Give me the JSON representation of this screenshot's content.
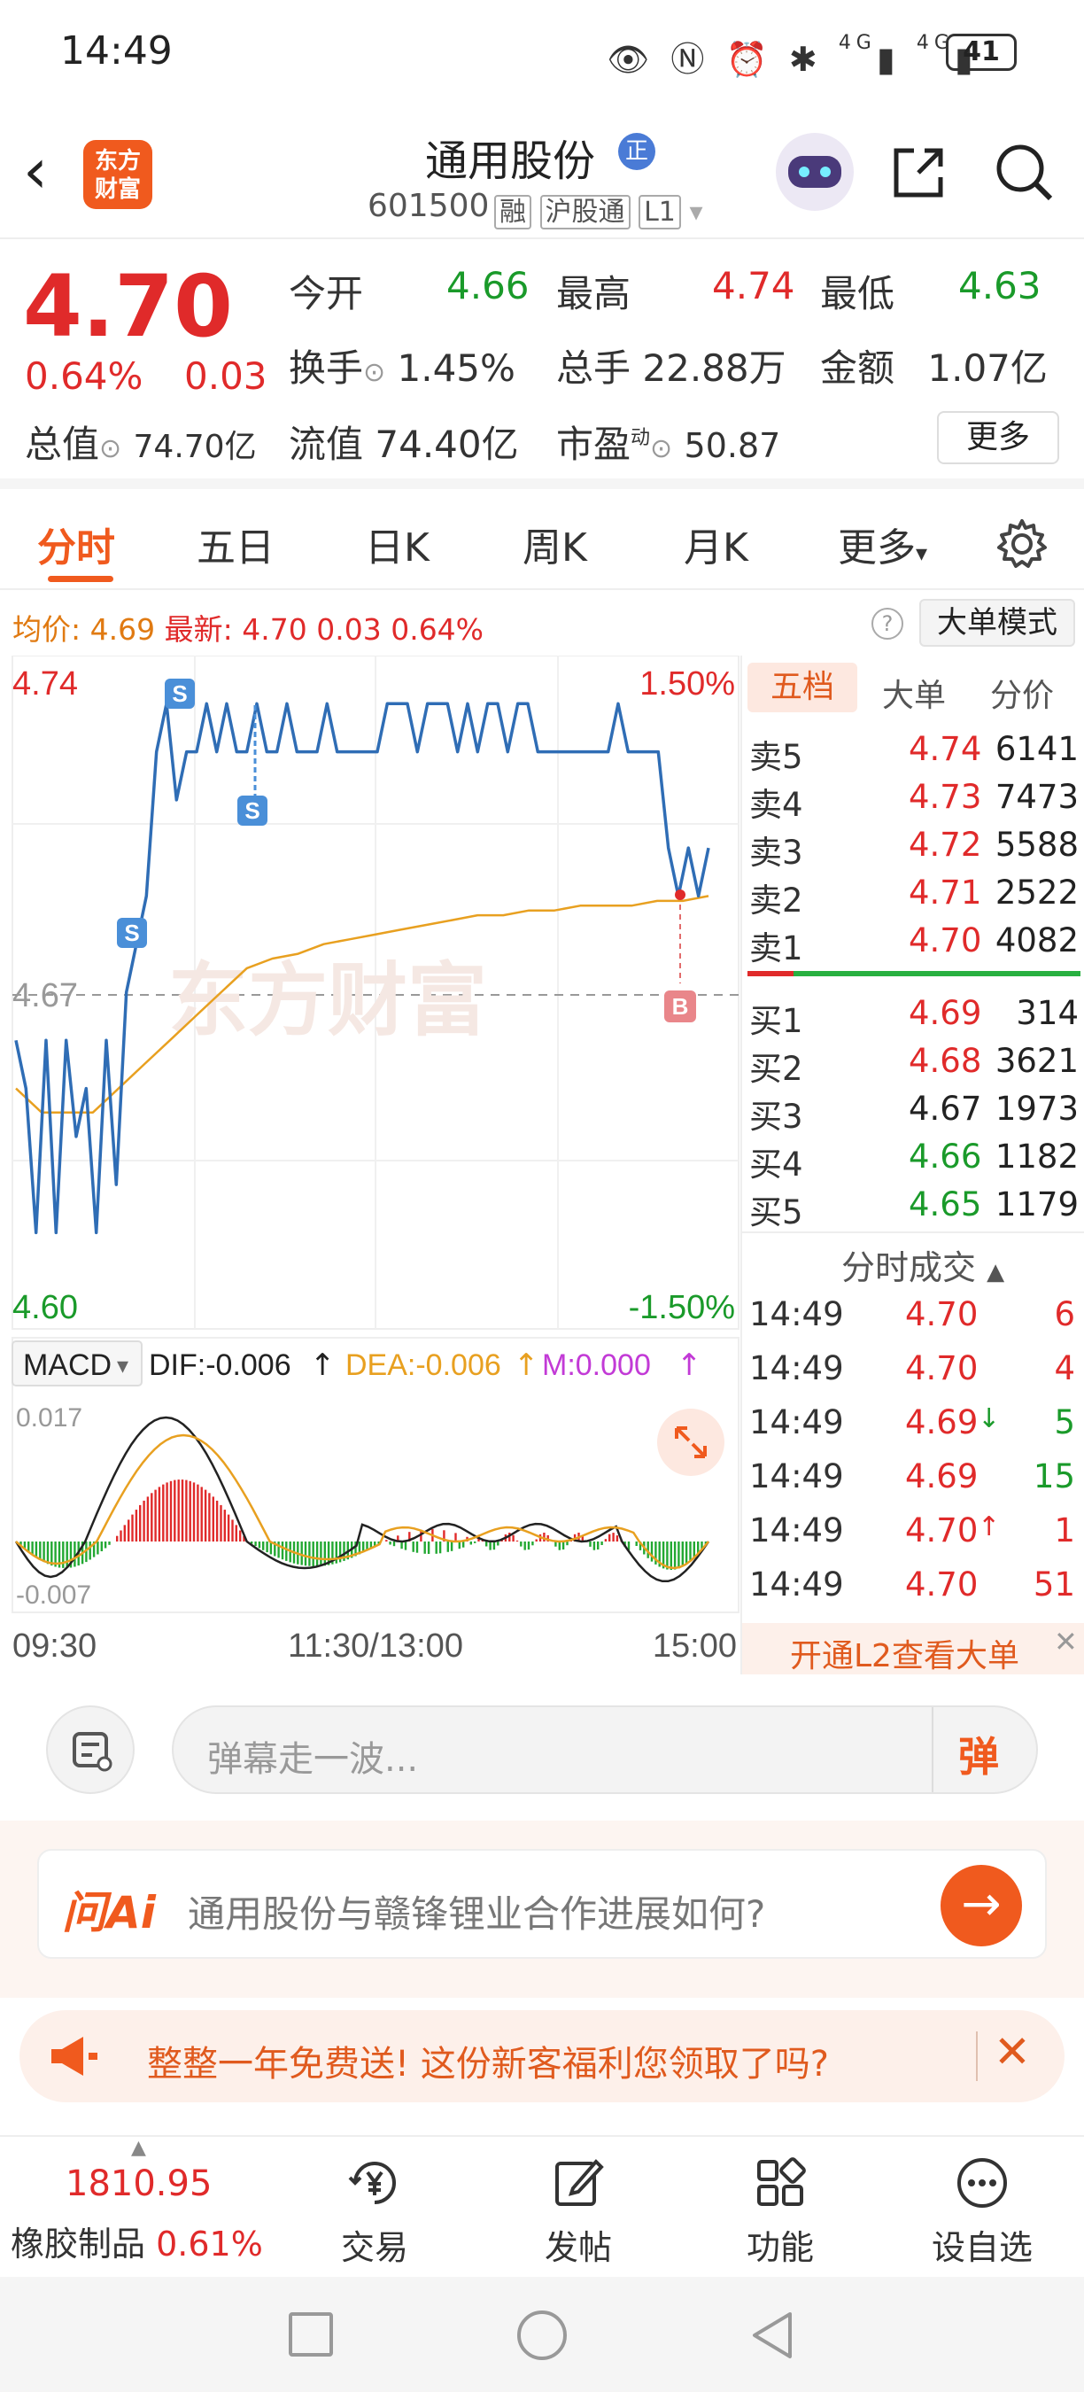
{
  "status_bar": {
    "time": "14:49",
    "battery": "41",
    "network1": "4G",
    "network2": "4G"
  },
  "header": {
    "logo_text": "东方财富",
    "stock_name": "通用股份",
    "name_badge": "正",
    "code": "601500",
    "tags": [
      "融",
      "沪股通",
      "L1"
    ]
  },
  "quote": {
    "price": "4.70",
    "change_pct": "0.64%",
    "change": "0.03",
    "total_value_label": "总值",
    "total_value": "74.70亿",
    "fields": [
      {
        "label": "今开",
        "value": "4.66"
      },
      {
        "label": "最高",
        "value": "4.74"
      },
      {
        "label": "最低",
        "value": "4.63"
      },
      {
        "label": "换手",
        "value": "1.45%"
      },
      {
        "label": "总手",
        "value": "22.88万"
      },
      {
        "label": "金额",
        "value": "1.07亿"
      },
      {
        "label": "流值",
        "value": "74.40亿"
      },
      {
        "label": "市盈",
        "sup": "动",
        "value": "50.87"
      }
    ],
    "more_label": "更多"
  },
  "tabs": [
    "分时",
    "五日",
    "日K",
    "周K",
    "月K",
    "更多"
  ],
  "avg_line": {
    "avg_label": "均价:",
    "avg_value": "4.69",
    "latest_label": "最新:",
    "latest_value": "4.70",
    "change": "0.03",
    "change_pct": "0.64%",
    "mode_button": "大单模式"
  },
  "chart": {
    "y_high": "4.74",
    "y_mid": "4.67",
    "y_low": "4.60",
    "pct_high": "1.50%",
    "pct_low": "-1.50%",
    "watermark": "东方财富",
    "marker_s": "S",
    "marker_b": "B",
    "macd_label": "MACD",
    "dif": "DIF:-0.006",
    "dea": "DEA:-0.006",
    "m": "M:0.000",
    "macd_top": "0.017",
    "macd_bottom": "-0.007",
    "time_start": "09:30",
    "time_mid": "11:30/13:00",
    "time_end": "15:00"
  },
  "chart_data": {
    "type": "line",
    "title": "",
    "xlabel": "",
    "ylabel": "",
    "x_range": [
      "09:30",
      "15:00"
    ],
    "ylim": [
      4.6,
      4.74
    ],
    "pct_range": [
      "-1.50%",
      "1.50%"
    ],
    "base_price": 4.67,
    "series": [
      {
        "name": "",
        "values": [
          4.66,
          4.65,
          4.62,
          4.66,
          4.62,
          4.66,
          4.64,
          4.65,
          4.62,
          4.66,
          4.63,
          4.67,
          4.68,
          4.69,
          4.72,
          4.73,
          4.71,
          4.72,
          4.72,
          4.73,
          4.72,
          4.73,
          4.72,
          4.72,
          4.73,
          4.72,
          4.72,
          4.73,
          4.72,
          4.72,
          4.72,
          4.73,
          4.72,
          4.72,
          4.72,
          4.72,
          4.72,
          4.73,
          4.73,
          4.73,
          4.72,
          4.73,
          4.73,
          4.73,
          4.72,
          4.73,
          4.72,
          4.73,
          4.73,
          4.72,
          4.73,
          4.73,
          4.72,
          4.72,
          4.72,
          4.72,
          4.72,
          4.72,
          4.72,
          4.72,
          4.73,
          4.72,
          4.72,
          4.72,
          4.72,
          4.7,
          4.69,
          4.7,
          4.69,
          4.7
        ]
      },
      {
        "name": "",
        "values": [
          4.65,
          4.645,
          4.645,
          4.645,
          4.65,
          4.655,
          4.66,
          4.665,
          4.67,
          4.675,
          4.677,
          4.678,
          4.68,
          4.681,
          4.682,
          4.683,
          4.684,
          4.685,
          4.686,
          4.686,
          4.687,
          4.687,
          4.688,
          4.688,
          4.688,
          4.689,
          4.689,
          4.69
        ]
      }
    ],
    "macd": {
      "dif": -0.006,
      "dea": -0.006,
      "m": 0.0,
      "ylim": [
        -0.007,
        0.017
      ]
    }
  },
  "book": {
    "tabs": [
      "五档",
      "大单",
      "分价"
    ],
    "asks": [
      {
        "label": "卖5",
        "price": "4.74",
        "vol": "6141"
      },
      {
        "label": "卖4",
        "price": "4.73",
        "vol": "7473"
      },
      {
        "label": "卖3",
        "price": "4.72",
        "vol": "5588"
      },
      {
        "label": "卖2",
        "price": "4.71",
        "vol": "2522"
      },
      {
        "label": "卖1",
        "price": "4.70",
        "vol": "4082"
      }
    ],
    "bids": [
      {
        "label": "买1",
        "price": "4.69",
        "vol": "314"
      },
      {
        "label": "买2",
        "price": "4.68",
        "vol": "3621"
      },
      {
        "label": "买3",
        "price": "4.67",
        "vol": "1973"
      },
      {
        "label": "买4",
        "price": "4.66",
        "vol": "1182"
      },
      {
        "label": "买5",
        "price": "4.65",
        "vol": "1179"
      }
    ],
    "trades_title": "分时成交",
    "trades": [
      {
        "time": "14:49",
        "price": "4.70",
        "arrow": "",
        "vol": "6"
      },
      {
        "time": "14:49",
        "price": "4.70",
        "arrow": "",
        "vol": "4"
      },
      {
        "time": "14:49",
        "price": "4.69",
        "arrow": "↓",
        "vol": "5"
      },
      {
        "time": "14:49",
        "price": "4.69",
        "arrow": "",
        "vol": "15"
      },
      {
        "time": "14:49",
        "price": "4.70",
        "arrow": "↑",
        "vol": "1"
      },
      {
        "time": "14:49",
        "price": "4.70",
        "arrow": "",
        "vol": "51"
      }
    ],
    "l2_banner": "开通L2查看大单"
  },
  "comment": {
    "placeholder": "弹幕走一波...",
    "danmu_label": "弹"
  },
  "ai": {
    "logo": "问Ai",
    "question": "通用股份与赣锋锂业合作进展如何?"
  },
  "promo": {
    "text": "整整一年免费送! 这份新客福利您领取了吗?"
  },
  "bottom_nav": {
    "index_value": "1810.95",
    "index_name": "橡胶制品",
    "index_pct": "0.61%",
    "items": [
      "交易",
      "发帖",
      "功能",
      "设自选"
    ]
  },
  "colors": {
    "up": "#e02a2a",
    "down": "#1a9a2a",
    "accent": "#f05a1e",
    "price_line": "#2f6db5",
    "avg_line": "#e8a020"
  }
}
